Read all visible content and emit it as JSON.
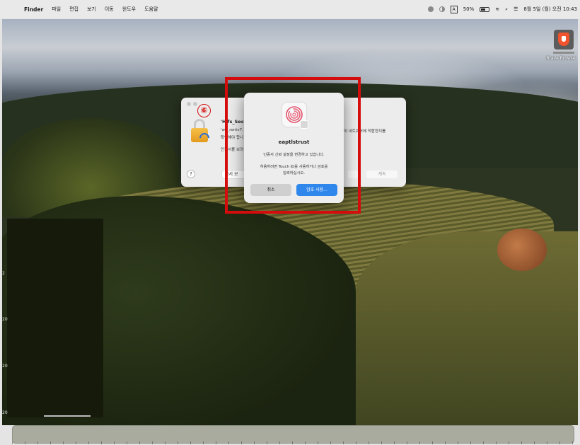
{
  "menubar": {
    "app_name": "Finder",
    "menus": [
      "파일",
      "편집",
      "보기",
      "이동",
      "윈도우",
      "도움말"
    ],
    "status": {
      "battery_percent": "50%",
      "input_method": "A",
      "clock": "8월 5일 (월) 오전 10:43"
    }
  },
  "desktop": {
    "icons": [
      {
        "label": "Brave Browse"
      }
    ],
    "edge_numbers": [
      "2",
      "20",
      "20",
      "20"
    ]
  },
  "background_window": {
    "title_fragment": "'Hifs_Sec",
    "line1": "'wif_rontv7.",
    "line2": "확인해야 합니",
    "line3": "이 네트워크에 적합한지를",
    "line4": "인증서를 보려",
    "show_cert_button": "증서 보",
    "continue_button": "계속",
    "help_label": "?"
  },
  "step_badge": "⑥",
  "auth_dialog": {
    "title": "eaptlstrust",
    "message": "인증서 신뢰 설정을 변경하고 있습니다.",
    "hint_line1": "허용하려면 Touch ID를 사용하거나 암호를",
    "hint_line2": "입력하십시오.",
    "cancel_label": "취소",
    "use_password_label": "암호 사용..."
  },
  "colors": {
    "highlight": "#d40c0c",
    "primary_button": "#2f87ec",
    "badge": "#d30f0f"
  }
}
